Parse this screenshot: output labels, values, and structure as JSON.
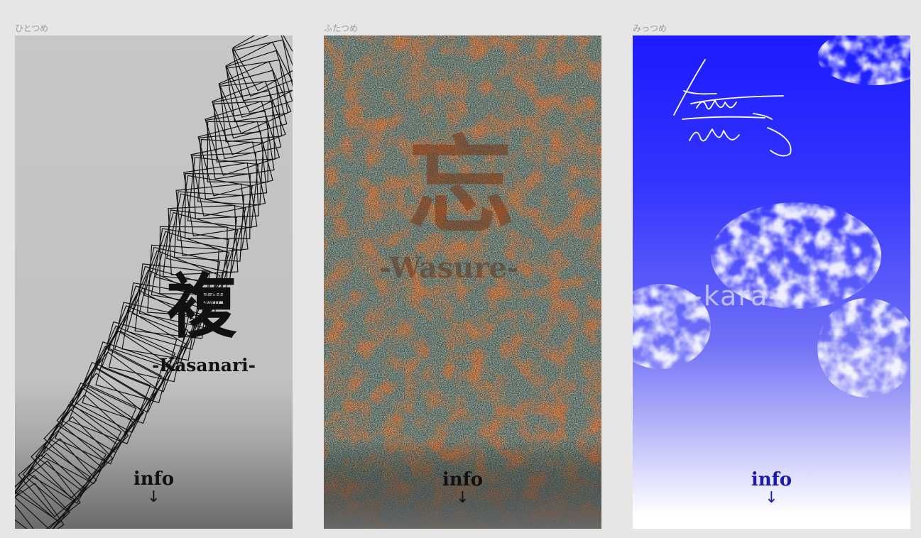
{
  "frames": [
    {
      "label": "ひとつめ",
      "kanji": "複",
      "subtitle": "-Kasanari-",
      "info": "info",
      "arrow": "↓",
      "text_color": "#111111"
    },
    {
      "label": "ふたつめ",
      "kanji": "忘",
      "subtitle": "-Wasure-",
      "info": "info",
      "arrow": "↓",
      "text_color": "#111111"
    },
    {
      "label": "みっつめ",
      "kanji": "無",
      "subtitle": "-kara-",
      "info": "info",
      "arrow": "↓",
      "text_color": "#1a1aa8"
    }
  ]
}
